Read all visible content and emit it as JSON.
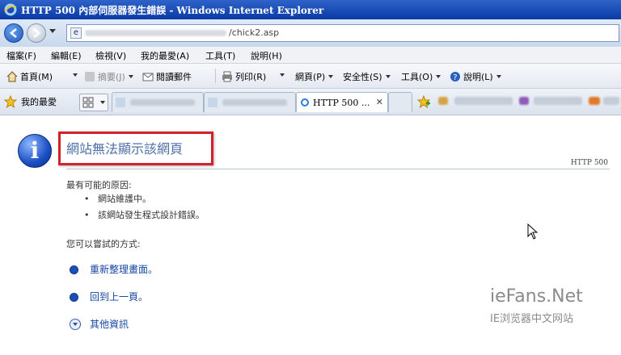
{
  "window": {
    "title": "HTTP 500 內部伺服器發生錯誤 - Windows Internet Explorer"
  },
  "address": {
    "url_visible": "/chick2.asp"
  },
  "menu": [
    "檔案(F)",
    "編輯(E)",
    "檢視(V)",
    "我的最愛(A)",
    "工具(T)",
    "說明(H)"
  ],
  "commands": {
    "home": "首頁(M)",
    "feeds": "摘要(J)",
    "read_mail": "閱讀郵件",
    "print": "列印(R)",
    "page": "網頁(P)",
    "safety": "安全性(S)",
    "tools": "工具(O)",
    "help": "說明(L)"
  },
  "favorites": {
    "label": "我的最愛",
    "active_tab": "HTTP 500 ..."
  },
  "page": {
    "heading": "網站無法顯示該網頁",
    "code": "HTTP 500",
    "causes_title": "最有可能的原因:",
    "causes": [
      "網站維護中。",
      "該網站發生程式設計錯誤。"
    ],
    "try_title": "您可以嘗試的方式:",
    "actions": [
      "重新整理畫面。",
      "回到上一頁。"
    ],
    "more": "其他資訊"
  },
  "watermark": {
    "line1": "ieFans.Net",
    "line2": "IE浏览器中文网站"
  },
  "colors": {
    "title_bar": "#0b3aa6",
    "heading": "#4e6fa8",
    "link": "#1747a6",
    "highlight_box": "#d3222a"
  }
}
